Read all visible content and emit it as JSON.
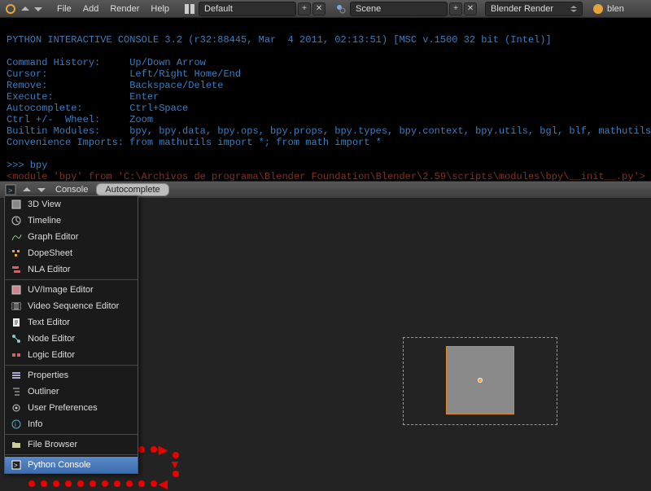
{
  "topbar": {
    "menu": [
      "File",
      "Add",
      "Render",
      "Help"
    ],
    "layout": "Default",
    "scene": "Scene",
    "engine": "Blender Render",
    "brand": "blen"
  },
  "console": {
    "header_line": "PYTHON INTERACTIVE CONSOLE 3.2 (r32:88445, Mar  4 2011, 02:13:51) [MSC v.1500 32 bit (Intel)]",
    "help": {
      "l1": "Command History:     Up/Down Arrow",
      "l2": "Cursor:              Left/Right Home/End",
      "l3": "Remove:              Backspace/Delete",
      "l4": "Execute:             Enter",
      "l5": "Autocomplete:        Ctrl+Space",
      "l6": "Ctrl +/-  Wheel:     Zoom",
      "l7": "Builtin Modules:     bpy, bpy.data, bpy.ops, bpy.props, bpy.types, bpy.context, bpy.utils, bgl, blf, mathutils",
      "l8": "Convenience Imports: from mathutils import *; from math import *"
    },
    "prompt": ">>> bpy",
    "result": "<module 'bpy' from 'C:\\Archivos de programa\\Blender Foundation\\Blender\\2.59\\scripts\\modules\\bpy\\__init__.py'>"
  },
  "console_header": {
    "menu": "Console",
    "autocomplete_btn": "Autocomplete"
  },
  "viewport": {
    "label": ""
  },
  "editor_menu": {
    "items": [
      "3D View",
      "Timeline",
      "Graph Editor",
      "DopeSheet",
      "NLA Editor",
      "-",
      "UV/Image Editor",
      "Video Sequence Editor",
      "Text Editor",
      "Node Editor",
      "Logic Editor",
      "-",
      "Properties",
      "Outliner",
      "User Preferences",
      "Info",
      "-",
      "File Browser",
      "-",
      "Python Console"
    ],
    "selected": "Python Console"
  }
}
